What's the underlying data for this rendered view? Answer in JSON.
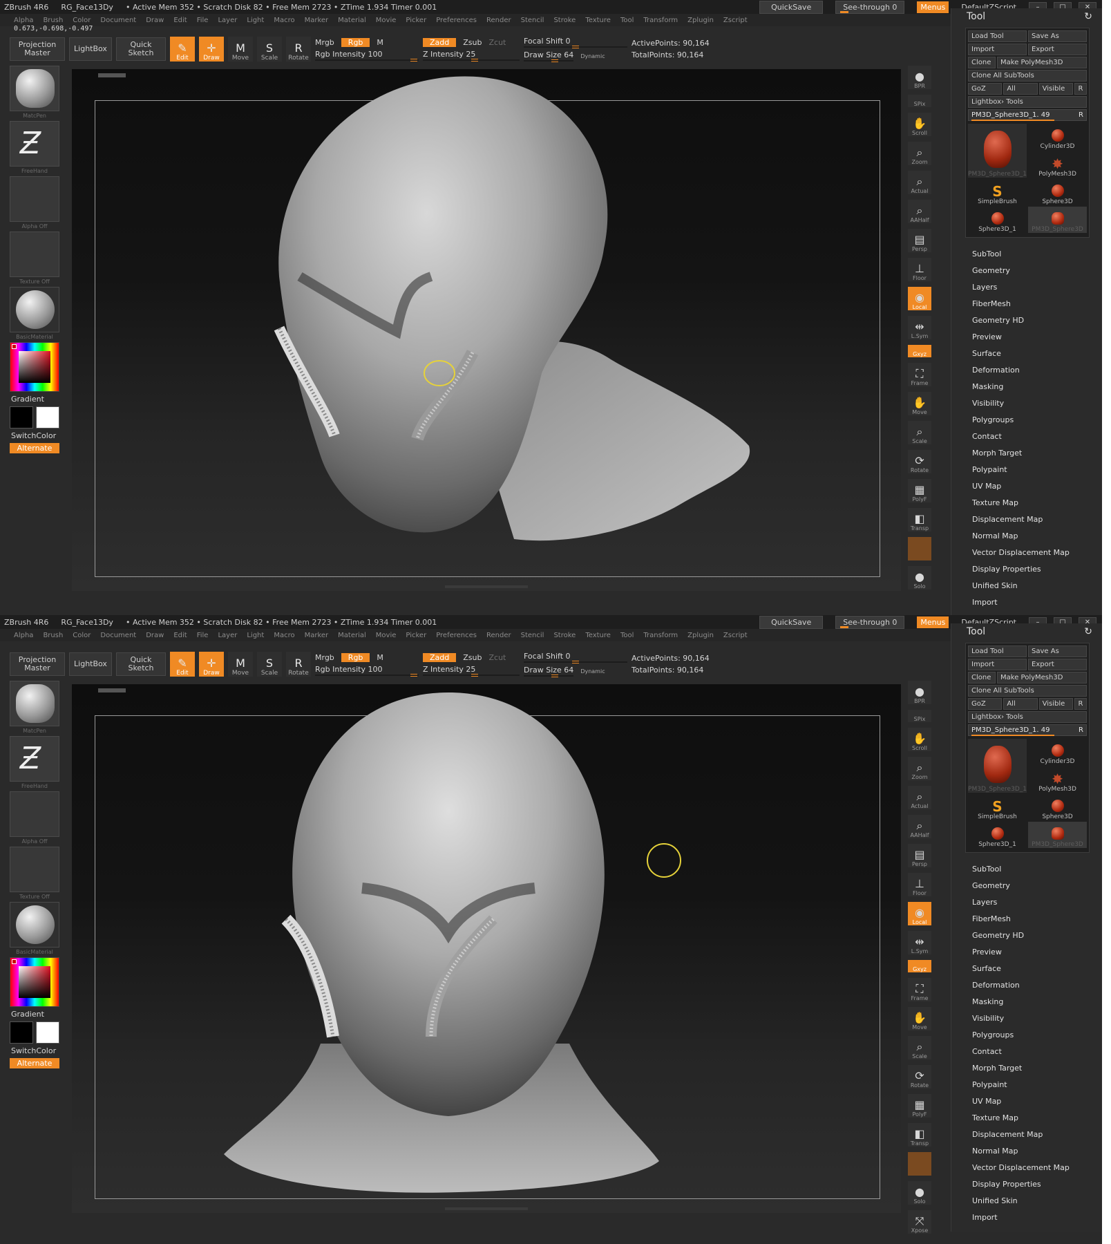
{
  "top": {
    "title": {
      "app": "ZBrush 4R6",
      "doc": "RG_Face13Dy",
      "stats": "• Active Mem 352 • Scratch Disk 82 • Free Mem 2723 • ZTime 1.934 Timer 0.001"
    },
    "coords": "0.673,-0.698,-0.497"
  },
  "bottom": {
    "title": {
      "app": "ZBrush 4R6",
      "doc": "RG_Face13Dy",
      "stats": "• Active Mem 352 • Scratch Disk 82 • Free Mem 2723 • ZTime 1.934 Timer 0.001"
    }
  },
  "titlebar": {
    "quicksave": "QuickSave",
    "seethrough": "See-through 0",
    "menus": "Menus",
    "script": "DefaultZScript"
  },
  "menus": [
    "Alpha",
    "Brush",
    "Color",
    "Document",
    "Draw",
    "Edit",
    "File",
    "Layer",
    "Light",
    "Macro",
    "Marker",
    "Material",
    "Movie",
    "Picker",
    "Preferences",
    "Render",
    "Stencil",
    "Stroke",
    "Texture",
    "Tool",
    "Transform",
    "Zplugin",
    "Zscript"
  ],
  "toolbar": {
    "projection_master": "Projection Master",
    "lightbox": "LightBox",
    "quick_sketch": "Quick Sketch",
    "edit": "Edit",
    "draw": "Draw",
    "move": "Move",
    "scale": "Scale",
    "rotate": "Rotate",
    "mrgb": "Mrgb",
    "rgb": "Rgb",
    "m": "M",
    "rgb_intensity": "Rgb Intensity 100",
    "zadd": "Zadd",
    "zsub": "Zsub",
    "zcut": "Zcut",
    "z_intensity": "Z Intensity 25",
    "focal_shift": "Focal Shift 0",
    "draw_size": "Draw Size 64",
    "dynamic": "Dynamic",
    "active_points": "ActivePoints: 90,164",
    "total_points": "TotalPoints: 90,164"
  },
  "leftshelf": {
    "brush": "MatcPen",
    "stroke": "FreeHand",
    "alpha": "Alpha Off",
    "texture": "Texture Off",
    "material": "BasicMaterial",
    "gradient": "Gradient",
    "switchcolor": "SwitchColor",
    "alternate": "Alternate",
    "colors": {
      "primary": "#000000",
      "secondary": "#ffffff",
      "accent": "#f08a24"
    }
  },
  "rightshelf": [
    "BPR",
    "SPix",
    "Scroll",
    "Zoom",
    "Actual",
    "AAHalf",
    "Persp",
    "Floor",
    "Local",
    "L.Sym",
    "Gxyz",
    "Frame",
    "Move",
    "Scale",
    "Rotate",
    "PolyF",
    "Transp",
    "Ghost",
    "Solo",
    "Xpose"
  ],
  "tool": {
    "title": "Tool",
    "load": "Load Tool",
    "save": "Save As",
    "import": "Import",
    "export": "Export",
    "clone": "Clone",
    "make_poly": "Make PolyMesh3D",
    "clone_all": "Clone All SubTools",
    "goz": "GoZ",
    "all": "All",
    "visible": "Visible",
    "r": "R",
    "lightbox_tools": "Lightbox› Tools",
    "current": "PM3D_Sphere3D_1. 49",
    "thumbs": [
      "Cylinder3D",
      "PolyMesh3D",
      "SimpleBrush",
      "Sphere3D",
      "Sphere3D_1",
      "PM3D_Sphere3D"
    ],
    "current_thumb": "PM3D_Sphere3D_1",
    "sections": [
      "SubTool",
      "Geometry",
      "Layers",
      "FiberMesh",
      "Geometry HD",
      "Preview",
      "Surface",
      "Deformation",
      "Masking",
      "Visibility",
      "Polygroups",
      "Contact",
      "Morph Target",
      "Polypaint",
      "UV Map",
      "Texture Map",
      "Displacement Map",
      "Normal Map",
      "Vector Displacement Map",
      "Display Properties",
      "Unified Skin",
      "Import"
    ]
  }
}
